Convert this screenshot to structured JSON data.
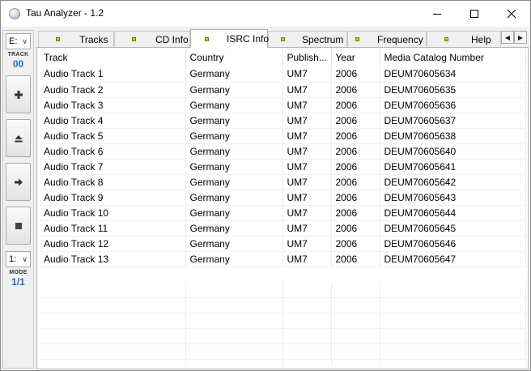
{
  "window": {
    "title": "Tau Analyzer - 1.2",
    "background_title": "...",
    "controls": {
      "minimize": "minimize-icon",
      "maximize": "maximize-icon",
      "close": "close-icon"
    }
  },
  "sidebar": {
    "drive_select": "E:",
    "track_label": "TRACK",
    "track_value": "00",
    "buttons": [
      "plus-icon",
      "eject-icon",
      "next-icon",
      "stop-icon"
    ],
    "mode_select": "1:",
    "mode_label": "MODE",
    "mode_value": "1/1"
  },
  "tabs": [
    {
      "label": "Tracks",
      "active": false
    },
    {
      "label": "CD Info",
      "active": false
    },
    {
      "label": "ISRC Info",
      "active": true
    },
    {
      "label": "Spectrum",
      "active": false
    },
    {
      "label": "Frequency",
      "active": false
    },
    {
      "label": "Help",
      "active": false
    }
  ],
  "table": {
    "columns": [
      "Track",
      "Country",
      "Publish...",
      "Year",
      "Media Catalog Number"
    ],
    "rows": [
      [
        "Audio Track 1",
        "Germany",
        "UM7",
        "2006",
        "DEUM70605634"
      ],
      [
        "Audio Track 2",
        "Germany",
        "UM7",
        "2006",
        "DEUM70605635"
      ],
      [
        "Audio Track 3",
        "Germany",
        "UM7",
        "2006",
        "DEUM70605636"
      ],
      [
        "Audio Track 4",
        "Germany",
        "UM7",
        "2006",
        "DEUM70605637"
      ],
      [
        "Audio Track 5",
        "Germany",
        "UM7",
        "2006",
        "DEUM70605638"
      ],
      [
        "Audio Track 6",
        "Germany",
        "UM7",
        "2006",
        "DEUM70605640"
      ],
      [
        "Audio Track 7",
        "Germany",
        "UM7",
        "2006",
        "DEUM70605641"
      ],
      [
        "Audio Track 8",
        "Germany",
        "UM7",
        "2006",
        "DEUM70605642"
      ],
      [
        "Audio Track 9",
        "Germany",
        "UM7",
        "2006",
        "DEUM70605643"
      ],
      [
        "Audio Track 10",
        "Germany",
        "UM7",
        "2006",
        "DEUM70605644"
      ],
      [
        "Audio Track 11",
        "Germany",
        "UM7",
        "2006",
        "DEUM70605645"
      ],
      [
        "Audio Track 12",
        "Germany",
        "UM7",
        "2006",
        "DEUM70605646"
      ],
      [
        "Audio Track 13",
        "Germany",
        "UM7",
        "2006",
        "DEUM70605647"
      ]
    ]
  },
  "colors": {
    "accent": "#1f6ed4",
    "tab_led": "#b9d300"
  }
}
